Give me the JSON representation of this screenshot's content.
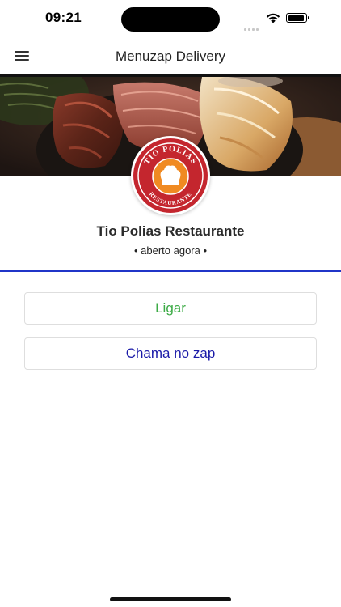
{
  "status_bar": {
    "time": "09:21",
    "signal_icon": "signal-icon",
    "wifi_icon": "wifi-icon",
    "battery_icon": "battery-icon"
  },
  "header": {
    "title": "Menuzap Delivery",
    "menu_icon": "hamburger-menu-icon"
  },
  "restaurant": {
    "name": "Tio Polias Restaurante",
    "status": "• aberto agora •",
    "logo_text_top": "TIO POLIAS",
    "logo_text_bottom": "RESTAURANTE"
  },
  "actions": {
    "call_label": "Ligar",
    "whatsapp_label": "Chama no zap"
  },
  "colors": {
    "call": "#3cab46",
    "link": "#1a1aa8",
    "accent_rule": "#2035c8",
    "logo_red": "#c4262e",
    "logo_orange": "#f08a22"
  }
}
